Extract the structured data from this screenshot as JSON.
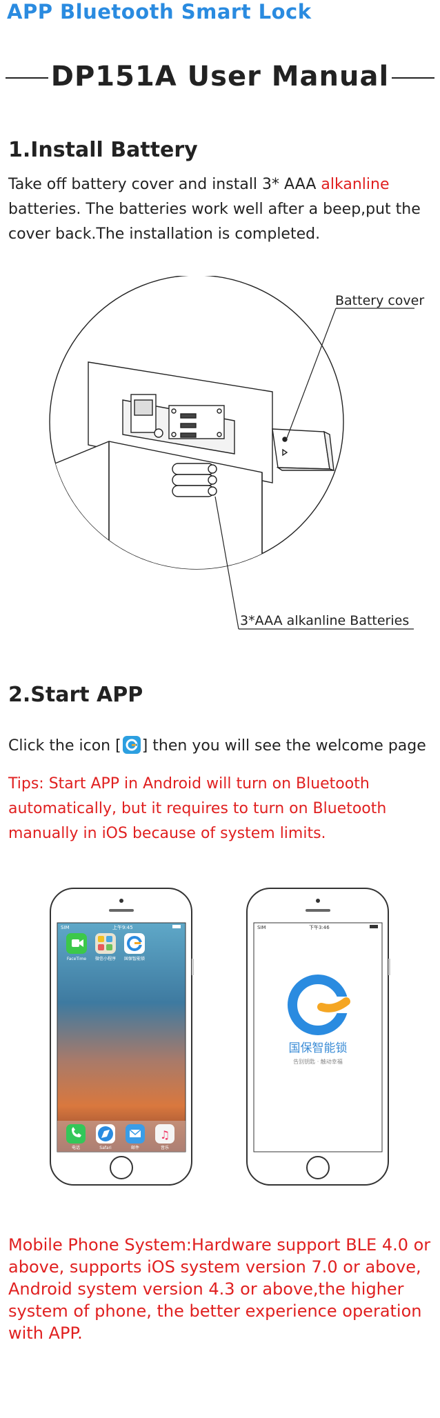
{
  "header": {
    "brand": "APP Bluetooth Smart Lock",
    "title": "DP151A User Manual"
  },
  "section1": {
    "heading": "1.Install Battery",
    "text_part1": "Take off battery cover and install 3* AAA  ",
    "text_highlight": "alkanline",
    "text_part2": "batteries. The batteries work well after a beep,put the cover back.The installation is completed.",
    "figure": {
      "label_cover": "Battery cover",
      "label_batteries": "3*AAA alkanline Batteries"
    }
  },
  "section2": {
    "heading": "2.Start  APP",
    "click_before": "Click the icon [",
    "click_after": "] then you will see the welcome page",
    "tips": "Tips:  Start APP in Android will turn on Bluetooth automatically, but it requires to turn on Bluetooth manually in iOS because of system limits.",
    "phone_left": {
      "status_left": "SIM",
      "status_time": "上午9:45",
      "apps": [
        {
          "label": "FaceTime",
          "color": "#3cc84a"
        },
        {
          "label": "微信小程序",
          "color": "#f0c020"
        },
        {
          "label": "国保智能锁",
          "color": "#ffffff"
        }
      ],
      "dock": [
        {
          "label": "电话",
          "color": "#34c759"
        },
        {
          "label": "Safari",
          "color": "#2a8be0"
        },
        {
          "label": "邮件",
          "color": "#3a9de8"
        },
        {
          "label": "音乐",
          "color": "#f5f5f5"
        }
      ]
    },
    "phone_right": {
      "status_left": "SIM",
      "status_time": "下午3:46",
      "logo_text": "国保智能锁",
      "slogan": "告别钥匙 · 触动幸福",
      "logo_blue": "#2a8be0",
      "logo_orange": "#f5a623"
    }
  },
  "footer_note": "Mobile  Phone System:Hardware support BLE 4.0 or above, supports iOS system version 7.0 or above, Android system version 4.3 or above,the higher system of phone, the better experience operation with APP."
}
